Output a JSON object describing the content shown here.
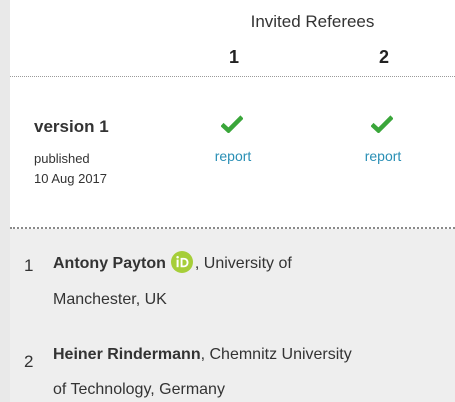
{
  "header": {
    "title": "Invited Referees",
    "columns": [
      "1",
      "2"
    ]
  },
  "version": {
    "label": "version 1",
    "status": "published",
    "date": "10 Aug 2017"
  },
  "reports": [
    {
      "status_icon": "approved-check-icon",
      "link_label": "report"
    },
    {
      "status_icon": "approved-check-icon",
      "link_label": "report"
    }
  ],
  "referees": [
    {
      "number": "1",
      "name": "Antony Payton",
      "has_orcid": true,
      "affiliation_part1": ", University of",
      "affiliation_part2": "Manchester, UK"
    },
    {
      "number": "2",
      "name": "Heiner Rindermann",
      "affiliation_part1": ", Chemnitz University",
      "affiliation_part2": "of Technology, Germany"
    }
  ],
  "colors": {
    "check": "#3aa63a",
    "link": "#2a8fb5",
    "orcid": "#a6ce39",
    "sidebar": "#e9e9e9",
    "referee_bg": "#eeeeee"
  }
}
